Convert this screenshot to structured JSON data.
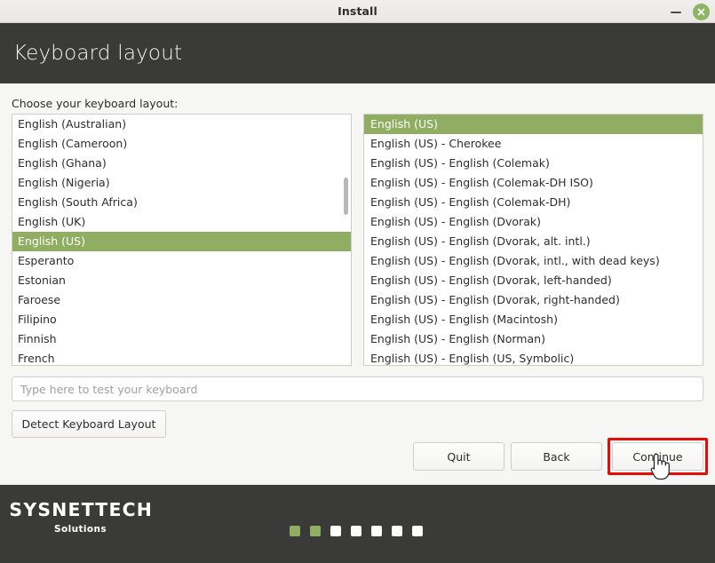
{
  "window": {
    "title": "Install",
    "minimize_icon": "minimize-icon",
    "close_icon": "close-icon",
    "close_color": "#8fb563"
  },
  "header": {
    "title": "Keyboard layout",
    "background": "#3a3a38"
  },
  "main": {
    "prompt": "Choose your keyboard layout:",
    "selection_color": "#8fae62",
    "left_list": {
      "selected": "English (US)",
      "items": [
        "English (Australian)",
        "English (Cameroon)",
        "English (Ghana)",
        "English (Nigeria)",
        "English (South Africa)",
        "English (UK)",
        "English (US)",
        "Esperanto",
        "Estonian",
        "Faroese",
        "Filipino",
        "Finnish",
        "French"
      ]
    },
    "right_list": {
      "selected": "English (US)",
      "items": [
        "English (US)",
        "English (US) - Cherokee",
        "English (US) - English (Colemak)",
        "English (US) - English (Colemak-DH ISO)",
        "English (US) - English (Colemak-DH)",
        "English (US) - English (Dvorak)",
        "English (US) - English (Dvorak, alt. intl.)",
        "English (US) - English (Dvorak, intl., with dead keys)",
        "English (US) - English (Dvorak, left-handed)",
        "English (US) - English (Dvorak, right-handed)",
        "English (US) - English (Macintosh)",
        "English (US) - English (Norman)",
        "English (US) - English (US, Symbolic)"
      ]
    },
    "test_field": {
      "value": "",
      "placeholder": "Type here to test your keyboard"
    },
    "detect_button": "Detect Keyboard Layout"
  },
  "nav": {
    "quit": "Quit",
    "back": "Back",
    "continue": "Continue",
    "highlight_color": "#e50c0c"
  },
  "footer": {
    "logo_main": "SYSNETTECH",
    "logo_sub": "Solutions",
    "dots": [
      "on",
      "on",
      "off",
      "off",
      "off",
      "off",
      "off"
    ],
    "dot_on_color": "#8fae62",
    "dot_off_color": "#ffffff"
  }
}
